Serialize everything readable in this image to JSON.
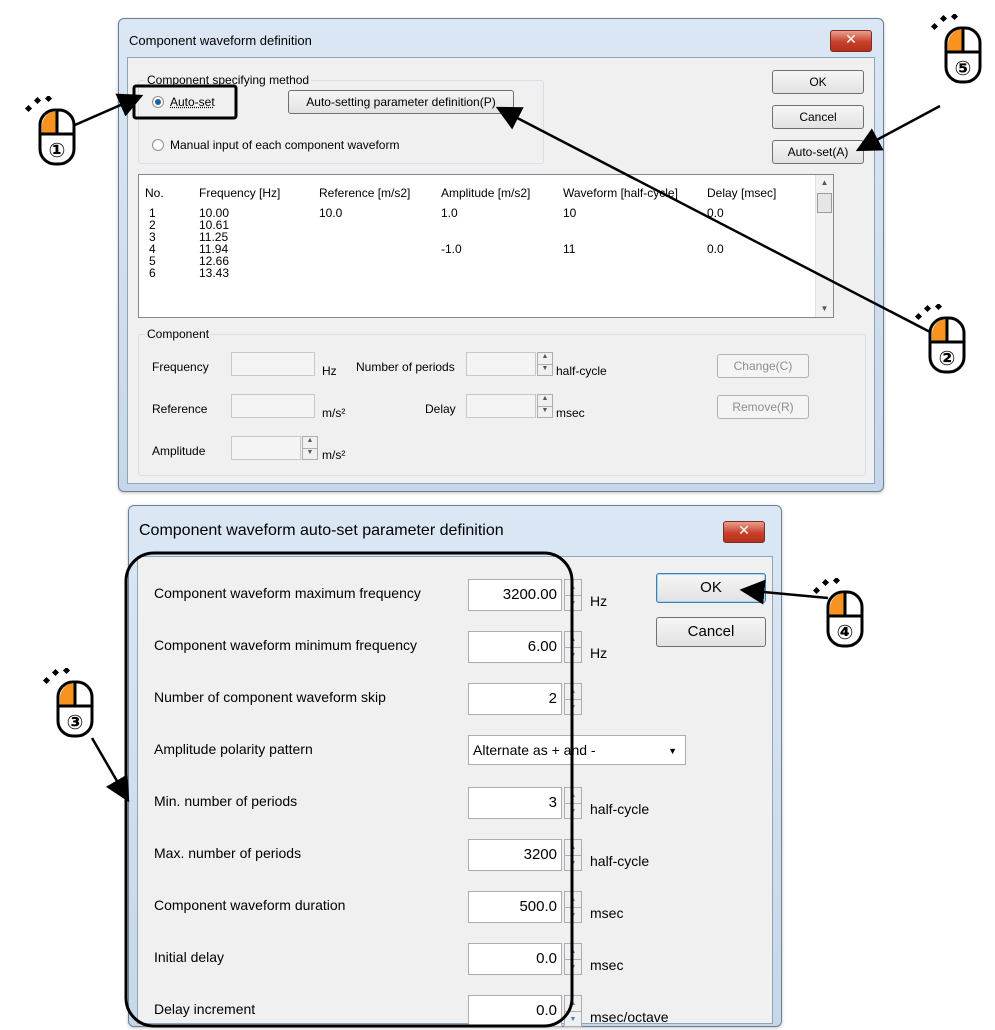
{
  "dialog1": {
    "title": "Component waveform definition",
    "close_icon": "close-icon",
    "group_method": "Component specifying method",
    "radio_autoset": "Auto-set",
    "radio_manual": "Manual input of each component waveform",
    "btn_params": "Auto-setting parameter definition(P)",
    "btn_ok": "OK",
    "btn_cancel": "Cancel",
    "btn_autoset": "Auto-set(A)",
    "list": {
      "headers": [
        "No.",
        "Frequency [Hz]",
        "Reference [m/s2]",
        "Amplitude [m/s2]",
        "Waveform [half-cycle]",
        "Delay [msec]"
      ],
      "rows": [
        {
          "no": "1",
          "freq": "10.00",
          "ref": "10.0",
          "amp": "1.0",
          "wave": "10",
          "delay": "0.0"
        },
        {
          "no": "2",
          "freq": "10.61",
          "ref": "",
          "amp": "",
          "wave": "",
          "delay": ""
        },
        {
          "no": "3",
          "freq": "11.25",
          "ref": "",
          "amp": "",
          "wave": "",
          "delay": ""
        },
        {
          "no": "4",
          "freq": "11.94",
          "ref": "",
          "amp": "-1.0",
          "wave": "11",
          "delay": "0.0"
        },
        {
          "no": "5",
          "freq": "12.66",
          "ref": "",
          "amp": "",
          "wave": "",
          "delay": ""
        },
        {
          "no": "6",
          "freq": "13.43",
          "ref": "",
          "amp": "",
          "wave": "",
          "delay": ""
        }
      ]
    },
    "group_component": "Component",
    "lbl_frequency": "Frequency",
    "unit_hz": "Hz",
    "lbl_periods": "Number of periods",
    "unit_half": "half-cycle",
    "lbl_reference": "Reference",
    "unit_ms2": "m/s²",
    "lbl_delay": "Delay",
    "unit_msec": "msec",
    "lbl_amplitude": "Amplitude",
    "unit_ms2b": "m/s²",
    "btn_change": "Change(C)",
    "btn_remove": "Remove(R)"
  },
  "dialog2": {
    "title": "Component waveform auto-set parameter definition",
    "btn_ok": "OK",
    "btn_cancel": "Cancel",
    "fields": [
      {
        "label": "Component waveform maximum frequency",
        "value": "3200.00",
        "unit": "Hz"
      },
      {
        "label": "Component waveform minimum frequency",
        "value": "6.00",
        "unit": "Hz"
      },
      {
        "label": "Number of component waveform skip",
        "value": "2",
        "unit": ""
      },
      {
        "label": "Amplitude polarity pattern",
        "value": "Alternate as + and -",
        "unit": ""
      },
      {
        "label": "Min. number of periods",
        "value": "3",
        "unit": "half-cycle"
      },
      {
        "label": "Max. number of periods",
        "value": "3200",
        "unit": "half-cycle"
      },
      {
        "label": "Component waveform duration",
        "value": "500.0",
        "unit": "msec"
      },
      {
        "label": "Initial delay",
        "value": "0.0",
        "unit": "msec"
      },
      {
        "label": "Delay increment",
        "value": "0.0",
        "unit": "msec/octave"
      }
    ]
  },
  "callouts": [
    "①",
    "②",
    "③",
    "④",
    "⑤"
  ],
  "colors": {
    "mouse_accent": "#f7931e",
    "arrow": "#000000",
    "title_bar": "#c6d7ea"
  }
}
